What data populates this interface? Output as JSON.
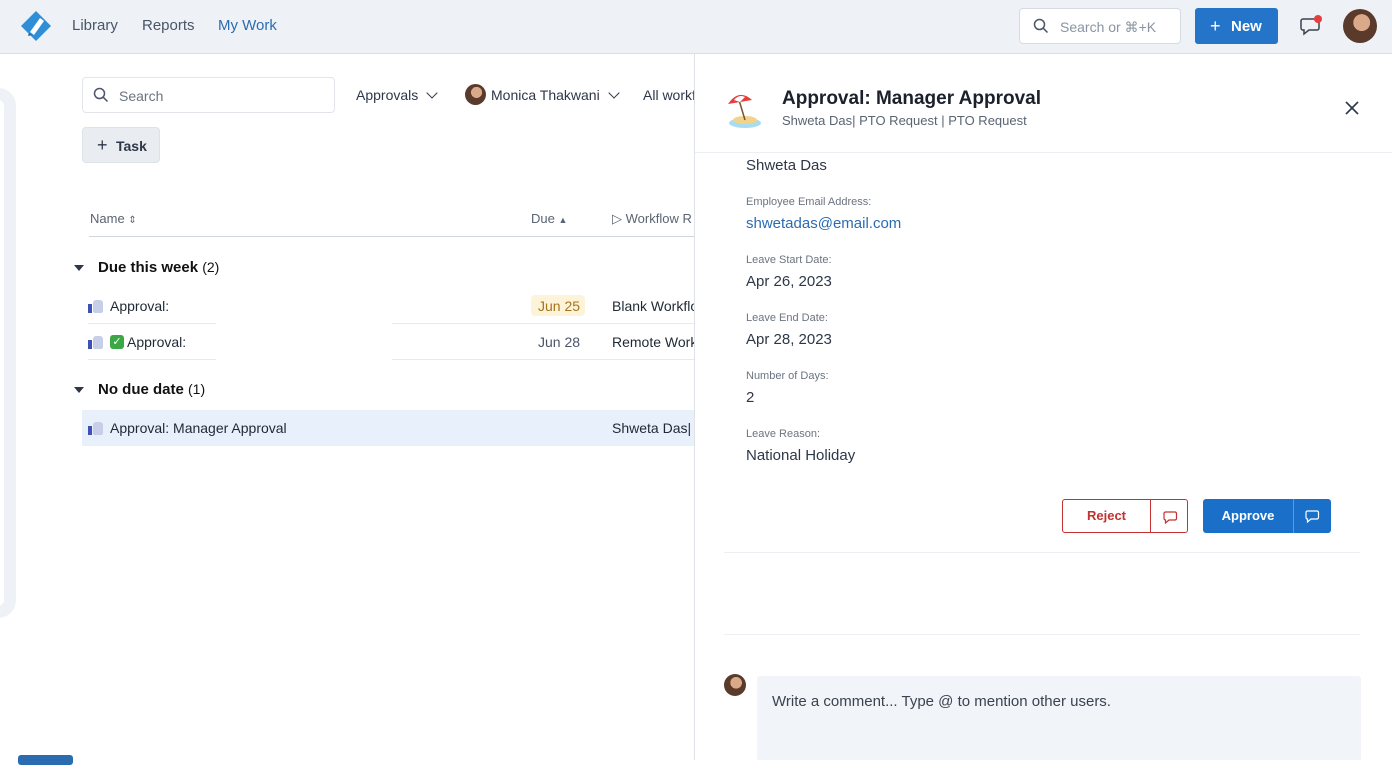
{
  "nav": {
    "items": [
      "Library",
      "Reports",
      "My Work"
    ],
    "active": "My Work"
  },
  "topbar": {
    "search_placeholder": "Search or ⌘+K",
    "new_label": "New"
  },
  "list": {
    "search_placeholder": "Search",
    "filters": {
      "type": "Approvals",
      "person": "Monica Thakwani",
      "workflows": "All workf"
    },
    "task_button": "Task",
    "columns": {
      "name": "Name",
      "due": "Due",
      "workflow": "Workflow R"
    },
    "groups": [
      {
        "title": "Due this week",
        "count": "(2)",
        "rows": [
          {
            "name": "Approval:",
            "due": "Jun 25",
            "workflow": "Blank Workflo"
          },
          {
            "name": "Approval:",
            "due": "Jun 28",
            "workflow": "Remote Work"
          }
        ]
      },
      {
        "title": "No due date",
        "count": "(1)",
        "rows": [
          {
            "name": "Approval: Manager Approval",
            "due": "",
            "workflow": "Shweta Das| P"
          }
        ]
      }
    ]
  },
  "panel": {
    "title": "Approval: Manager Approval",
    "subtitle": "Shweta Das| PTO Request | PTO Request",
    "fields": {
      "employee_name": "Shweta Das",
      "email_label": "Employee Email Address:",
      "email": "shwetadas@email.com",
      "start_label": "Leave Start Date:",
      "start": "Apr 26, 2023",
      "end_label": "Leave End Date:",
      "end": "Apr 28, 2023",
      "days_label": "Number of Days:",
      "days": "2",
      "reason_label": "Leave Reason:",
      "reason": "National Holiday"
    },
    "reject_label": "Reject",
    "approve_label": "Approve",
    "comment_placeholder": "Write a comment... Type @ to mention other users."
  },
  "colors": {
    "accent": "#2474c9",
    "reject": "#c53030",
    "due_highlight": "#fdf3d9",
    "selected_row": "#e8f0fb"
  }
}
